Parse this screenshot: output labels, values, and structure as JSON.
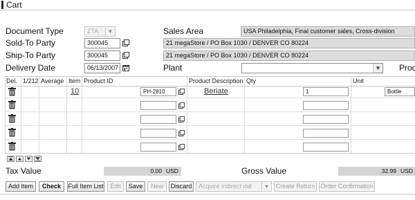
{
  "title": "Cart",
  "header": {
    "document_type": {
      "label": "Document Type",
      "value": "ZTA"
    },
    "sales_area": {
      "label": "Sales Area",
      "value": "USA Philadelphia, Final customer sales, Cross-division"
    },
    "sold_to": {
      "label": "Sold-To Party",
      "value": "300045",
      "address": "21 megaStore / PO Box 1030 / DENVER CO 80224"
    },
    "ship_to": {
      "label": "Ship-To Party",
      "value": "300045",
      "address": "21 megaStore / PO Box 1030 / DENVER CO 80224"
    },
    "delivery_date": {
      "label": "Delivery Date",
      "value": "06/13/2007"
    },
    "plant": {
      "label": "Plant",
      "value": ""
    },
    "product_cut": {
      "label": "Prod"
    }
  },
  "table": {
    "columns": [
      "Del.",
      "1/212",
      "Average",
      "Item",
      "Product ID",
      "Product Description",
      "Qty",
      "Unit"
    ],
    "rows": [
      {
        "item": "10",
        "product_id": "PH-2810",
        "description": "Beriate",
        "qty": "1",
        "unit": "Bottle"
      },
      {
        "item": "",
        "product_id": "",
        "description": "",
        "qty": "",
        "unit": ""
      },
      {
        "item": "",
        "product_id": "",
        "description": "",
        "qty": "",
        "unit": ""
      },
      {
        "item": "",
        "product_id": "",
        "description": "",
        "qty": "",
        "unit": ""
      },
      {
        "item": "",
        "product_id": "",
        "description": "",
        "qty": "",
        "unit": ""
      }
    ]
  },
  "totals": {
    "tax": {
      "label": "Tax Value",
      "amount": "0.00",
      "currency": "USD"
    },
    "gross": {
      "label": "Gross Value",
      "amount": "32.99",
      "currency": "USD"
    }
  },
  "toolbar": {
    "add_item": "Add Item",
    "check": "Check",
    "full_item_list": "Full Item List",
    "edit": "Edit",
    "save": "Save",
    "new": "New",
    "discard": "Discard",
    "acquire_placeholder": "Acquire indirect dat",
    "create_return": "Create Return",
    "order_confirmation": "Order Confirmation"
  },
  "icons": {
    "search": "value-help-icon",
    "calendar": "calendar-icon",
    "delete": "trash-icon"
  }
}
